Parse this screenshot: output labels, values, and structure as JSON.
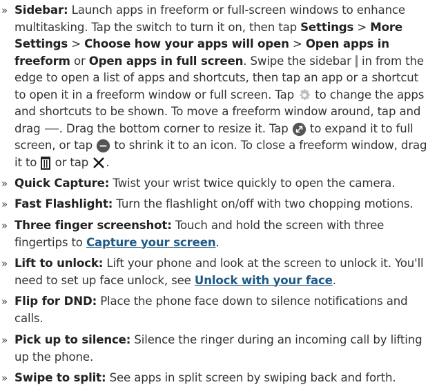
{
  "bullet": "»",
  "sidebar": {
    "title": "Sidebar:",
    "t1": "Launch apps in freeform or full-screen windows to enhance multitasking. Tap the switch to turn it on, then tap",
    "settings": "Settings",
    "sep1": ">",
    "more_settings": "More Settings",
    "sep2": ">",
    "choose": "Choose how your apps will open",
    "sep3": ">",
    "open_freeform": "Open apps in freeform",
    "or1": "or",
    "open_full": "Open apps in full screen",
    "t2": ". Swipe the sidebar",
    "t3": "in from the edge to open a list of apps and shortcuts, then tap an app or a shortcut to open it in a freeform window or full screen. Tap",
    "t4": "to change the apps and shortcuts to be shown. To move a freeform window around, tap and drag",
    "t5": ". Drag the bottom corner to resize it. Tap",
    "t6": "to expand it to full screen, or tap",
    "t7": "to shrink it to an icon. To close a freeform window, drag it to",
    "t8": "or tap",
    "t9": "."
  },
  "quick_capture": {
    "title": "Quick Capture:",
    "text": "Twist your wrist twice quickly to open the camera."
  },
  "fast_flashlight": {
    "title": "Fast Flashlight:",
    "text": "Turn the flashlight on/off with two chopping motions."
  },
  "three_finger": {
    "title": "Three finger screenshot:",
    "text": "Touch and hold the screen with three fingertips to",
    "link": "Capture your screen",
    "end": "."
  },
  "lift_unlock": {
    "title": "Lift to unlock:",
    "text": "Lift your phone and look at the screen to unlock it. You'll need to set up face unlock, see",
    "link": "Unlock with your face",
    "end": "."
  },
  "flip_dnd": {
    "title": "Flip for DND:",
    "text": "Place the phone face down to silence notifications and calls."
  },
  "pick_up": {
    "title": "Pick up to silence:",
    "text": "Silence the ringer during an incoming call by lifting up the phone."
  },
  "swipe_split": {
    "title": "Swipe to split:",
    "text": "See apps in split screen by swiping back and forth."
  },
  "icons": [
    "sidebar-handle-icon",
    "gear-icon",
    "drag-handle-icon",
    "expand-icon",
    "minimize-icon",
    "trash-icon",
    "close-icon"
  ],
  "colors": {
    "link": "#1e5a85",
    "icon_gray": "#555555",
    "text": "#333333"
  }
}
